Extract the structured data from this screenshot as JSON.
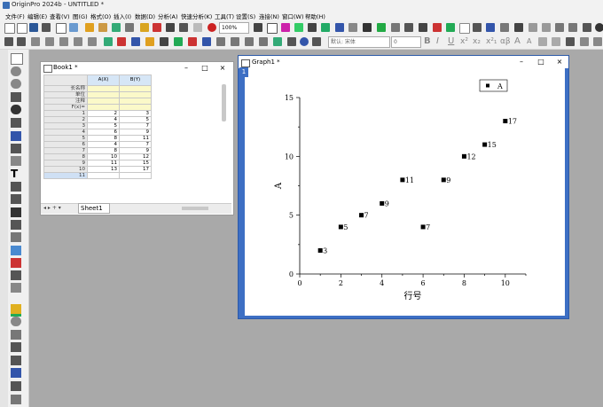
{
  "app": {
    "title": "OriginPro 2024b - UNTITLED *"
  },
  "menu": [
    "文件(F)",
    "编辑(E)",
    "查看(V)",
    "图(G)",
    "格式(O)",
    "插入(I)",
    "数据(D)",
    "分析(A)",
    "快速分析(K)",
    "工具(T)",
    "设置(S)",
    "连接(N)",
    "窗口(W)",
    "帮助(H)"
  ],
  "toolbar": {
    "zoom": "100%",
    "font": "默认: 宋体",
    "font_size": "0"
  },
  "book": {
    "title": "Book1 *",
    "columns": [
      "A(X)",
      "B(Y)"
    ],
    "meta_rows": [
      "长名称",
      "单位",
      "注释",
      "F(x)="
    ],
    "rows": [
      [
        "1",
        "2",
        "3"
      ],
      [
        "2",
        "4",
        "5"
      ],
      [
        "3",
        "5",
        "7"
      ],
      [
        "4",
        "6",
        "9"
      ],
      [
        "5",
        "8",
        "11"
      ],
      [
        "6",
        "4",
        "7"
      ],
      [
        "7",
        "8",
        "9"
      ],
      [
        "8",
        "10",
        "12"
      ],
      [
        "9",
        "11",
        "15"
      ],
      [
        "10",
        "13",
        "17"
      ],
      [
        "11",
        "",
        ""
      ]
    ],
    "sheet_tab": "Sheet1"
  },
  "graph": {
    "title": "Graph1 *",
    "layer": "1"
  },
  "chart_data": {
    "type": "scatter",
    "series": [
      {
        "name": "A",
        "x": [
          1,
          2,
          3,
          4,
          5,
          6,
          7,
          8,
          9,
          10
        ],
        "y": [
          2,
          4,
          5,
          6,
          8,
          4,
          8,
          10,
          11,
          13
        ],
        "labels": [
          "3",
          "5",
          "7",
          "9",
          "11",
          "7",
          "9",
          "12",
          "15",
          "17"
        ]
      }
    ],
    "xlabel": "行号",
    "ylabel": "A",
    "xlim": [
      0,
      11
    ],
    "ylim": [
      0,
      15
    ],
    "xticks": [
      "0",
      "2",
      "4",
      "6",
      "8",
      "10"
    ],
    "yticks": [
      "0",
      "5",
      "10",
      "15"
    ],
    "legend": "top-right",
    "marker_color": "#000000"
  }
}
